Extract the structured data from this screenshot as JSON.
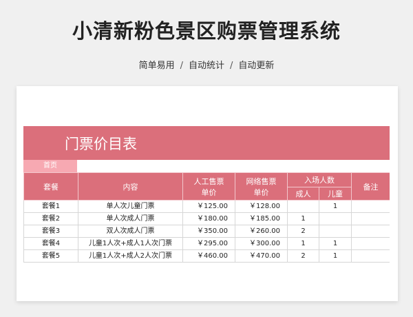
{
  "page": {
    "title": "小清新粉色景区购票管理系统",
    "tags": [
      "简单易用",
      "自动统计",
      "自动更新"
    ]
  },
  "sheet": {
    "banner_title": "门票价目表",
    "home_tab": "首页",
    "headers": {
      "package": "套餐",
      "content": "内容",
      "manual_price_line1": "人工售票",
      "manual_price_line2": "单价",
      "online_price_line1": "网络售票",
      "online_price_line2": "单价",
      "entry_count": "入场人数",
      "adult": "成人",
      "child": "儿童",
      "remarks": "备注"
    },
    "rows": [
      {
        "package": "套餐1",
        "content": "单人次儿童门票",
        "manual": "￥125.00",
        "online": "￥128.00",
        "adult": "",
        "child": "1",
        "remarks": ""
      },
      {
        "package": "套餐2",
        "content": "单人次成人门票",
        "manual": "￥180.00",
        "online": "￥185.00",
        "adult": "1",
        "child": "",
        "remarks": ""
      },
      {
        "package": "套餐3",
        "content": "双人次成人门票",
        "manual": "￥350.00",
        "online": "￥260.00",
        "adult": "2",
        "child": "",
        "remarks": ""
      },
      {
        "package": "套餐4",
        "content": "儿童1人次+成人1人次门票",
        "manual": "￥295.00",
        "online": "￥300.00",
        "adult": "1",
        "child": "1",
        "remarks": ""
      },
      {
        "package": "套餐5",
        "content": "儿童1人次+成人2人次门票",
        "manual": "￥460.00",
        "online": "￥470.00",
        "adult": "2",
        "child": "1",
        "remarks": ""
      }
    ]
  }
}
